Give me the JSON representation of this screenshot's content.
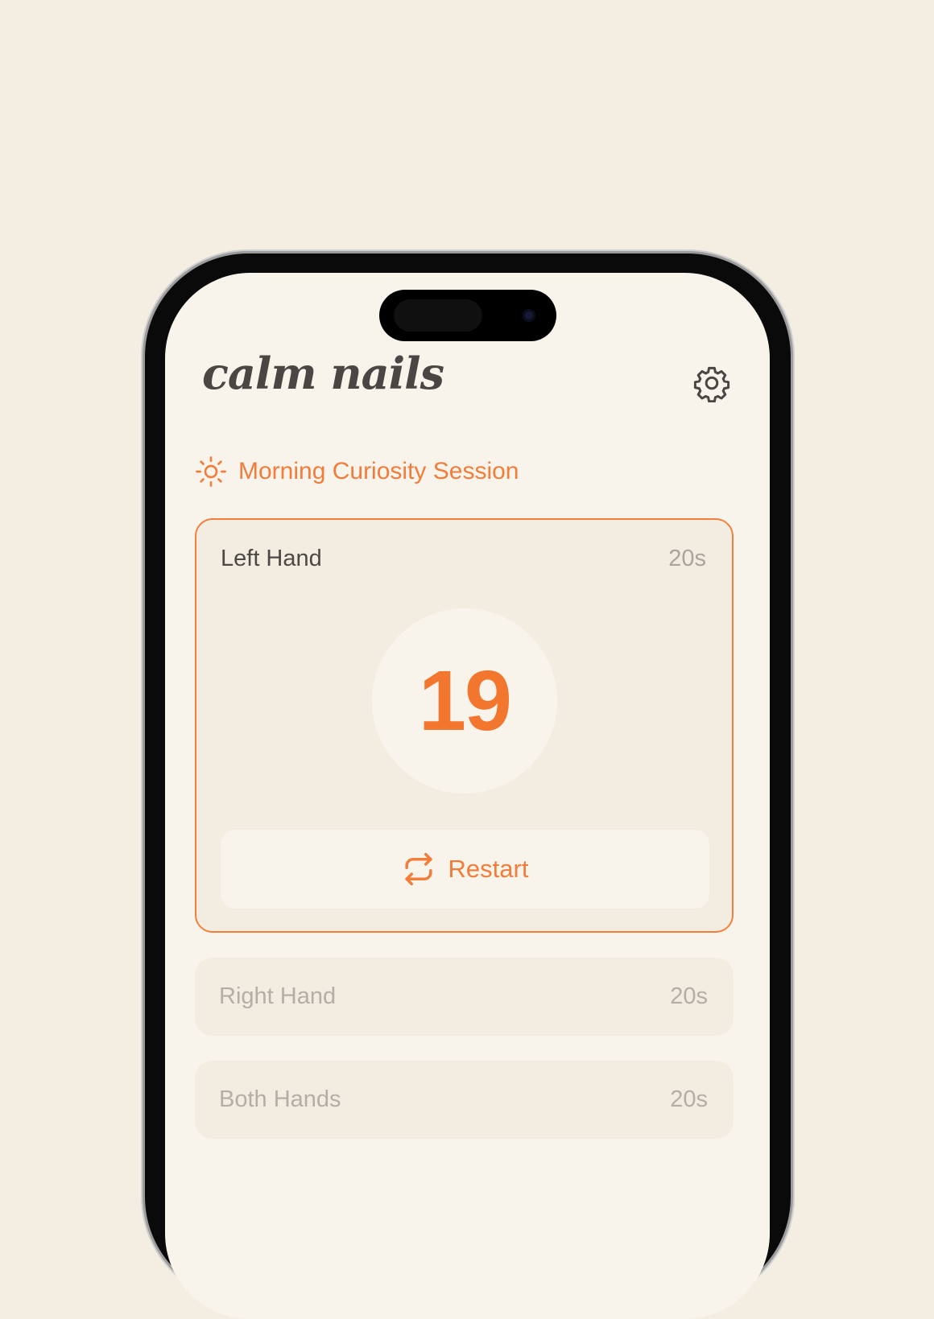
{
  "app": {
    "logo_text": "calm nails"
  },
  "header": {
    "settings_icon": "gear-icon"
  },
  "session": {
    "icon": "sun-icon",
    "title": "Morning Curiosity Session"
  },
  "exercises": [
    {
      "label": "Left Hand",
      "duration": "20s",
      "active": true
    },
    {
      "label": "Right Hand",
      "duration": "20s",
      "active": false
    },
    {
      "label": "Both Hands",
      "duration": "20s",
      "active": false
    }
  ],
  "timer": {
    "value": "19"
  },
  "restart": {
    "label": "Restart",
    "icon": "repeat-icon"
  },
  "colors": {
    "accent": "#f27c3a",
    "background": "#f4ede2",
    "screen": "#f8f4ec",
    "card": "#f3ece1",
    "text_dark": "#4b4846",
    "text_muted": "#b4aea5"
  }
}
